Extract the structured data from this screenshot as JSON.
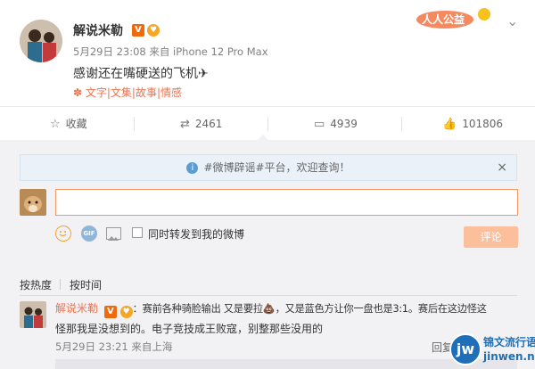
{
  "post": {
    "author": "解说米勒",
    "meta": "5月29日 23:08 来自 iPhone 12 Pro Max",
    "text": "感谢还在嘴硬送的飞机✈",
    "tags": "✽ 文字|文集|故事|情感",
    "charity_label": "人人公益",
    "menu_glyph": "⌄"
  },
  "actions": {
    "favorite": {
      "icon": "star-icon",
      "label": "收藏"
    },
    "repost": {
      "icon": "repost-icon",
      "count": "2461"
    },
    "comment": {
      "icon": "comment-icon",
      "count": "4939"
    },
    "like": {
      "icon": "thumbs-up-icon",
      "count": "101806"
    }
  },
  "comment_box": {
    "notice": "#微博辟谣#平台，欢迎查询！",
    "info_glyph": "i",
    "close_glyph": "×",
    "input_value": "",
    "repost_option": "同时转发到我的微博",
    "submit": "评论",
    "toolbar_icons": [
      "emoji-icon",
      "gif-icon",
      "image-icon"
    ]
  },
  "sort_tabs": {
    "hot": "按热度",
    "time": "按时间"
  },
  "comment": {
    "author": "解说米勒",
    "line1": "：赛前各种骑脸输出 又是要拉💩，又是蓝色方让你一盘也是3:1。赛后在这边怪这",
    "line2": "怪那我是没想到的。电子竞技成王败寇，别整那些没用的",
    "meta": "5月29日 23:21 来自上海",
    "reply": "回复"
  },
  "watermark": {
    "logo": "jw",
    "title": "锦文流行语",
    "url": "jinwen.net"
  },
  "colors": {
    "accent": "#eb7350",
    "button": "#fbbf9c",
    "link": "#eb7350"
  }
}
